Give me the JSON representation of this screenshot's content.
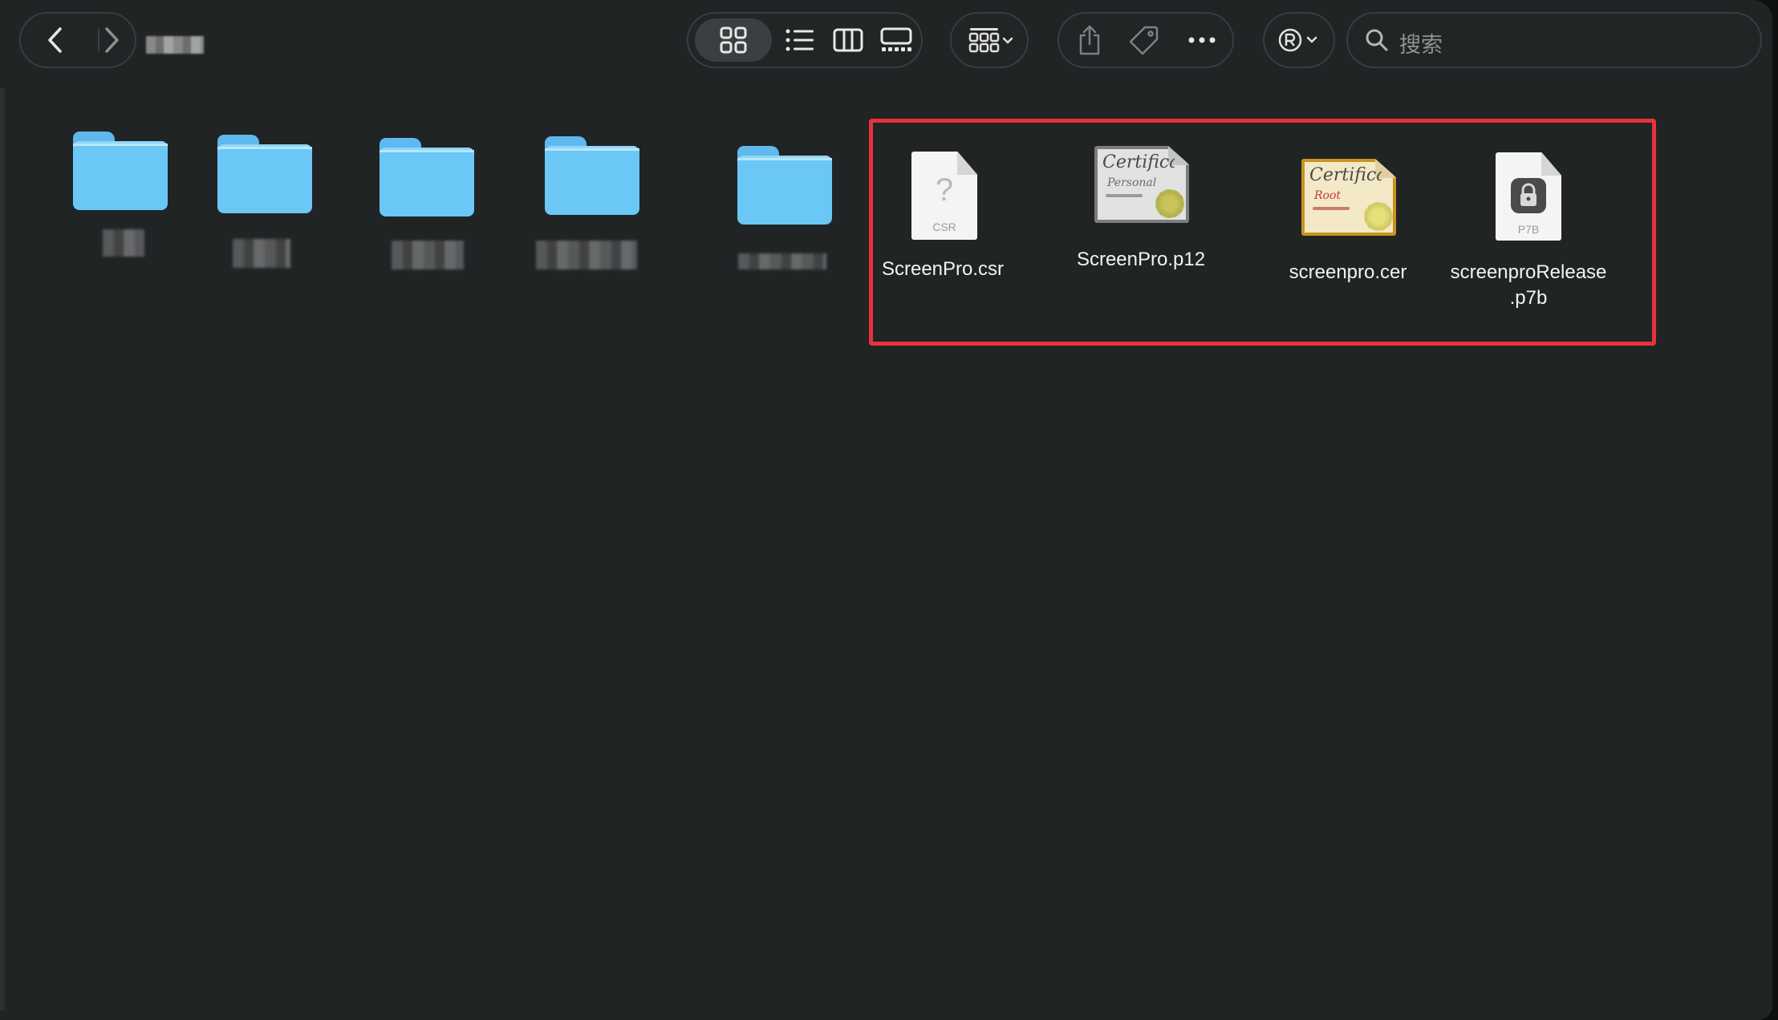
{
  "toolbar": {
    "back_icon": "chevron-left-icon",
    "forward_icon": "chevron-right-icon",
    "view_icons": [
      "grid-view-icon",
      "list-view-icon",
      "column-view-icon",
      "gallery-view-icon"
    ],
    "group_icon": "group-by-icon",
    "share_icon": "share-icon",
    "tag_icon": "tag-icon",
    "more_icon": "ellipsis-icon",
    "extension_icon": "registered-icon",
    "search_placeholder": "搜索"
  },
  "folders": [
    {
      "name": "folder-1"
    },
    {
      "name": "folder-2"
    },
    {
      "name": "folder-3"
    },
    {
      "name": "folder-4"
    },
    {
      "name": "folder-5"
    }
  ],
  "files": [
    {
      "label": "ScreenPro.csr",
      "ext": "CSR",
      "icon": "csr-document-icon"
    },
    {
      "label": "ScreenPro.p12",
      "script": "Certifica",
      "sub": "Personal",
      "icon": "personal-certificate-icon"
    },
    {
      "label": "screenpro.cer",
      "script": "Certifica",
      "sub": "Root",
      "icon": "root-certificate-icon"
    },
    {
      "label_line1": "screenproRelease",
      "label_line2": ".p7b",
      "ext": "P7B",
      "icon": "p7b-keychain-icon"
    }
  ],
  "colors": {
    "window_bg": "#212425",
    "folder_blue": "#6ac7f6",
    "highlight_red": "#e8313d"
  }
}
